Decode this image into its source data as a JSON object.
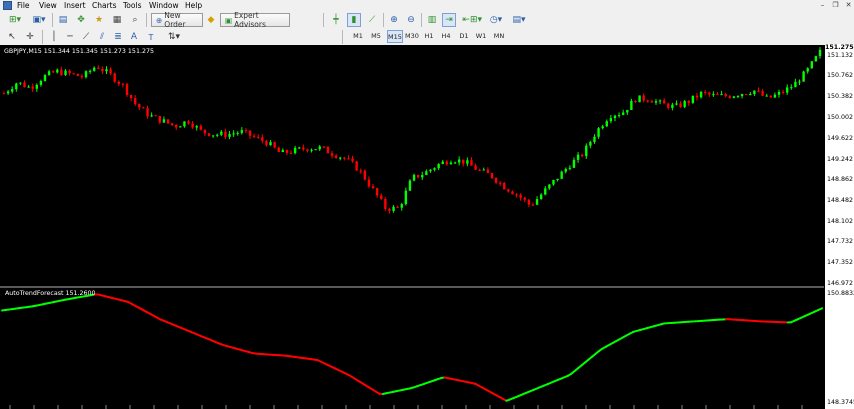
{
  "menu": {
    "items": [
      "File",
      "View",
      "Insert",
      "Charts",
      "Tools",
      "Window",
      "Help"
    ]
  },
  "toolbar": {
    "new_order_label": "New Order",
    "expert_advisors_label": "Expert Advisors",
    "timeframes": [
      "M1",
      "M5",
      "M15",
      "M30",
      "H1",
      "H4",
      "D1",
      "W1",
      "MN"
    ]
  },
  "chart": {
    "symbol_header": "GBPJPY,M15  151.344 151.345 151.273 151.275",
    "price_labels": [
      "151.275",
      "151.132",
      "150.762",
      "150.382",
      "150.002",
      "149.622",
      "149.242",
      "148.862",
      "148.482",
      "148.102",
      "147.732",
      "147.352",
      "146.972"
    ],
    "indicator_header": "AutoTrendForecast 151.2600",
    "indicator_labels": [
      "150.8832",
      "148.3745"
    ],
    "colors": {
      "up_candle": "#00ff00",
      "down_candle": "#ff0000",
      "background": "#000000",
      "up_line": "#00ff00",
      "down_line": "#ff0000"
    }
  },
  "chart_data": {
    "type": "line",
    "title": "GBPJPY,M15",
    "series": [
      {
        "name": "GBPJPY,M15",
        "values": [
          150.45,
          150.65,
          150.55,
          150.75,
          150.85,
          150.8,
          150.75,
          150.95,
          150.8,
          150.6,
          150.25,
          150.05,
          149.95,
          149.85,
          149.95,
          149.75,
          149.7,
          149.7,
          149.75,
          149.65,
          149.55,
          149.35,
          149.4,
          149.45,
          149.45,
          149.35,
          149.25,
          149.05,
          148.7,
          148.35,
          148.35,
          148.9,
          149.0,
          149.15,
          149.25,
          149.2,
          149.05,
          148.95,
          148.75,
          148.6,
          148.4,
          148.65,
          148.9,
          149.15,
          149.35,
          149.75,
          150.05,
          150.1,
          150.35,
          150.35,
          150.25,
          150.2,
          150.3,
          150.45,
          150.4,
          150.4,
          150.45,
          150.5,
          150.35,
          150.45,
          150.6,
          150.85,
          151.2
        ]
      },
      {
        "name": "AutoTrendForecast",
        "values": [
          150.5,
          150.6,
          150.75,
          150.88,
          150.7,
          150.3,
          150.0,
          149.7,
          149.5,
          149.45,
          149.35,
          149.0,
          148.55,
          148.7,
          148.95,
          148.8,
          148.4,
          148.7,
          149.0,
          149.6,
          150.0,
          150.2,
          150.25,
          150.3,
          150.25,
          150.22,
          150.55
        ]
      }
    ],
    "ylim": [
      146.972,
      151.275
    ]
  }
}
